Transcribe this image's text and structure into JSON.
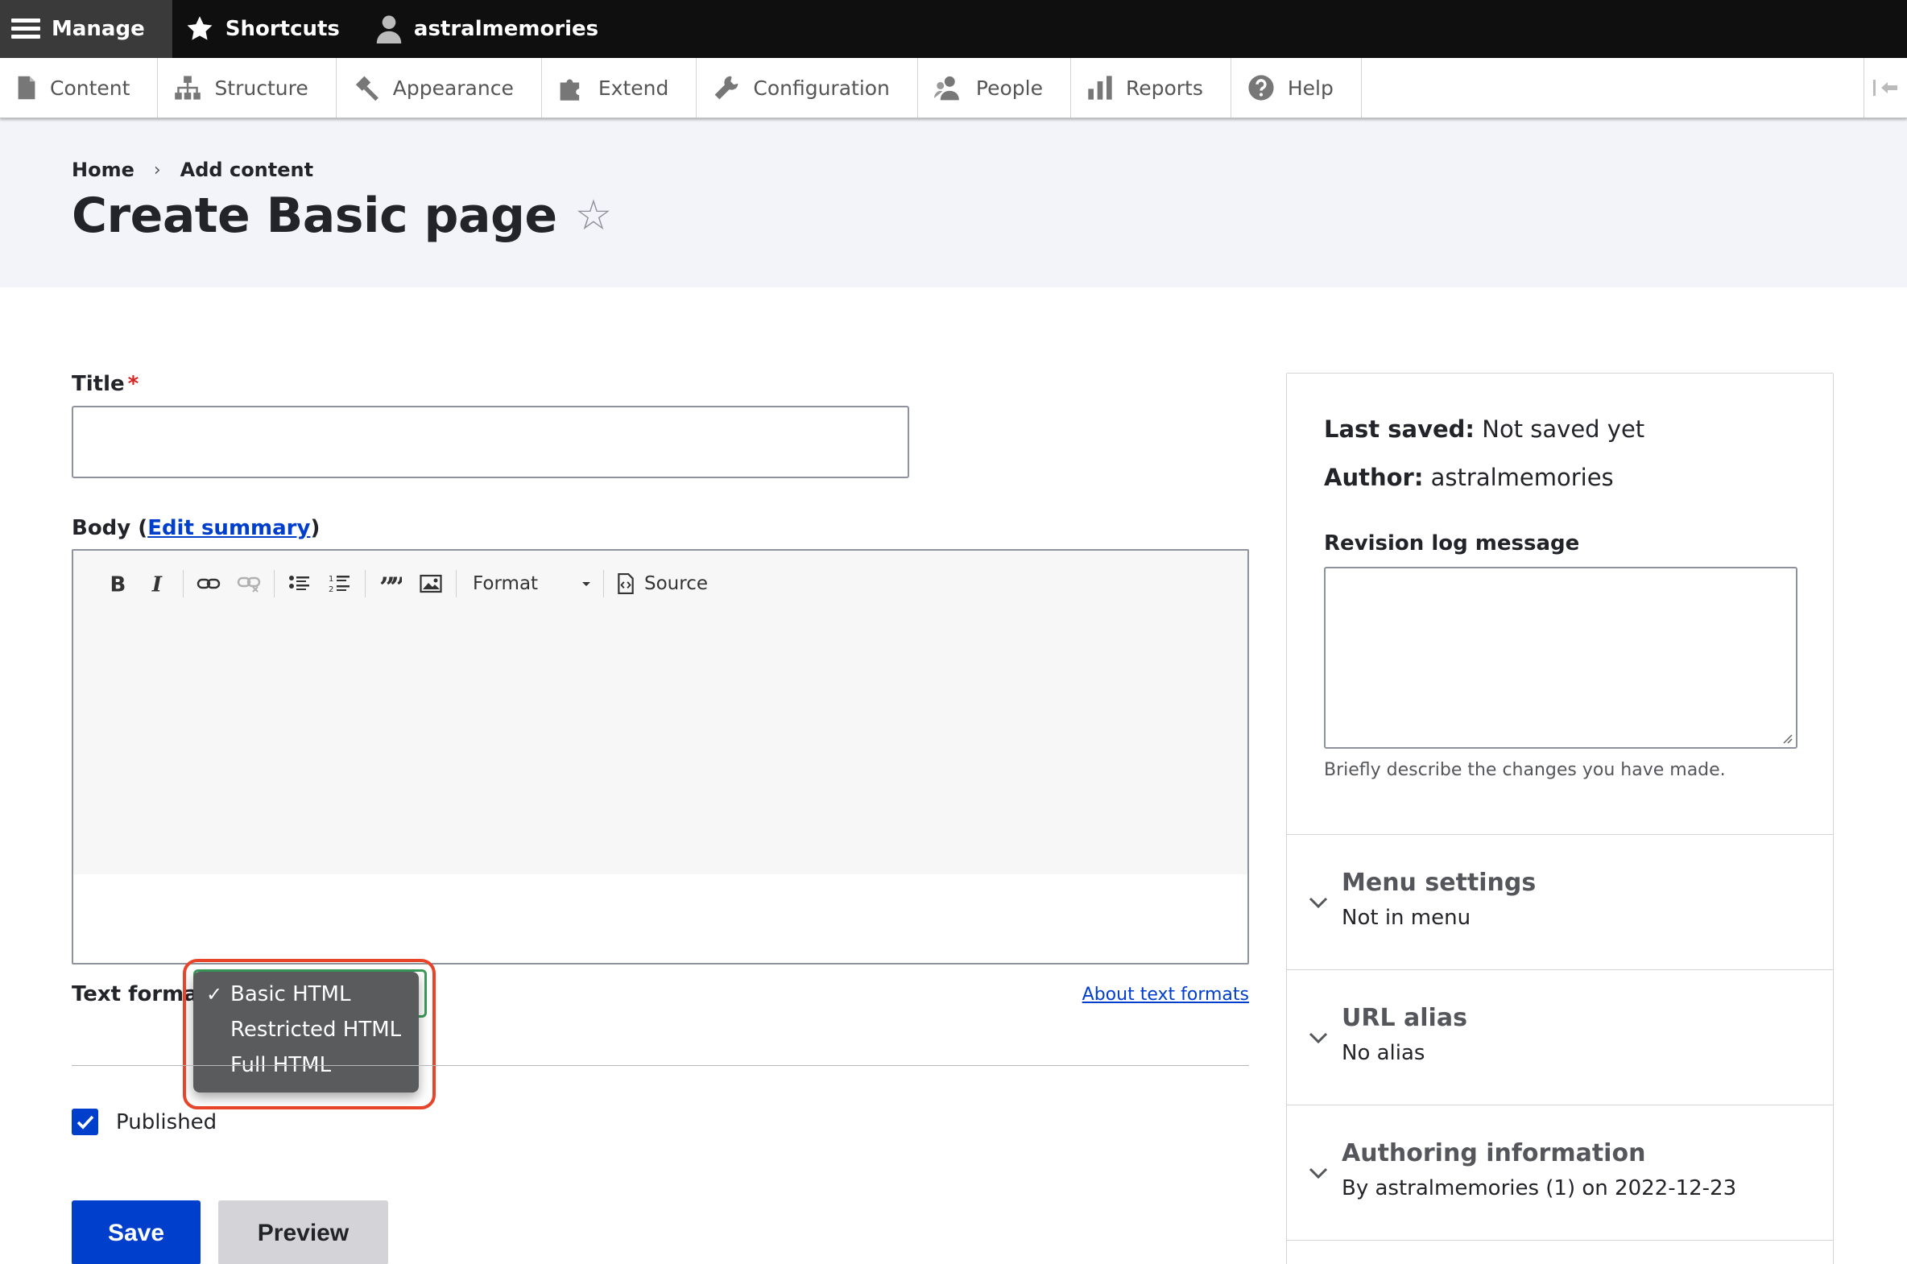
{
  "toolbar": {
    "manage": "Manage",
    "shortcuts": "Shortcuts",
    "user": "astralmemories"
  },
  "tray": {
    "items": [
      {
        "label": "Content",
        "icon": "document-icon"
      },
      {
        "label": "Structure",
        "icon": "sitemap-icon"
      },
      {
        "label": "Appearance",
        "icon": "paintbrush-icon"
      },
      {
        "label": "Extend",
        "icon": "puzzle-icon"
      },
      {
        "label": "Configuration",
        "icon": "wrench-icon"
      },
      {
        "label": "People",
        "icon": "people-icon"
      },
      {
        "label": "Reports",
        "icon": "bar-chart-icon"
      },
      {
        "label": "Help",
        "icon": "help-icon"
      }
    ]
  },
  "breadcrumb": {
    "home": "Home",
    "sep": "›",
    "add_content": "Add content"
  },
  "page": {
    "title": "Create Basic page",
    "star": "☆"
  },
  "form": {
    "title_label": "Title",
    "required_mark": "*",
    "body_label_prefix": "Body (",
    "edit_summary": "Edit summary",
    "body_label_suffix": ")",
    "editor": {
      "format_label": "Format",
      "source_label": "Source"
    },
    "text_format_label": "Text format",
    "about_text_formats": "About text formats",
    "text_format_options": [
      {
        "label": "Basic HTML",
        "selected": true
      },
      {
        "label": "Restricted HTML",
        "selected": false
      },
      {
        "label": "Full HTML",
        "selected": false
      }
    ],
    "check_mark": "✓",
    "published_label": "Published",
    "published_checked": true,
    "save_label": "Save",
    "preview_label": "Preview"
  },
  "sidebar": {
    "last_saved_label": "Last saved:",
    "last_saved_value": "Not saved yet",
    "author_label": "Author:",
    "author_value": "astralmemories",
    "revision_label": "Revision log message",
    "revision_description": "Briefly describe the changes you have made.",
    "sections": [
      {
        "title": "Menu settings",
        "summary": "Not in menu"
      },
      {
        "title": "URL alias",
        "summary": "No alias"
      },
      {
        "title": "Authoring information",
        "summary": "By astralmemories (1) on 2022-12-23"
      }
    ]
  },
  "colors": {
    "primary_blue": "#003ecc",
    "highlight_ring": "#e8442a",
    "toolbar_black": "#0f0f0f"
  }
}
